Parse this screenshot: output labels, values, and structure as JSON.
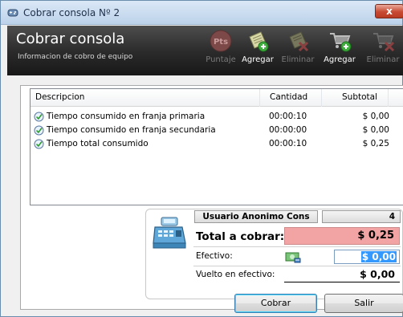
{
  "window": {
    "title": "Cobrar consola Nº 2",
    "close_label": "x"
  },
  "header": {
    "title": "Cobrar consola",
    "subtitle": "Informacion de cobro de equipo"
  },
  "toolbar": {
    "badge_text": "Pts",
    "items": [
      {
        "label": "Puntaje",
        "enabled": false,
        "icon": "points-icon"
      },
      {
        "label": "Agregar",
        "enabled": true,
        "icon": "add-document-icon"
      },
      {
        "label": "Eliminar",
        "enabled": false,
        "icon": "delete-document-icon"
      },
      {
        "label": "Agregar",
        "enabled": true,
        "icon": "add-cart-icon"
      },
      {
        "label": "Eliminar",
        "enabled": false,
        "icon": "delete-cart-icon"
      }
    ]
  },
  "table": {
    "columns": [
      "Descripcion",
      "Cantidad",
      "Subtotal"
    ],
    "rows": [
      {
        "descripcion": "Tiempo consumido en franja primaria",
        "cantidad": "00:00:10",
        "subtotal": "$ 0,00"
      },
      {
        "descripcion": "Tiempo consumido en franja secundaria",
        "cantidad": "00:00:00",
        "subtotal": "$ 0,00"
      },
      {
        "descripcion": "Tiempo total consumido",
        "cantidad": "00:00:10",
        "subtotal": "$ 0,25"
      }
    ]
  },
  "payment": {
    "user_name": "Usuario Anonimo Cons",
    "user_count": "4",
    "total_label": "Total a cobrar:",
    "total_value": "$ 0,25",
    "efectivo_label": "Efectivo:",
    "efectivo_value": "$ 0,00",
    "vuelto_label": "Vuelto en efectivo:",
    "vuelto_value": "$ 0,00"
  },
  "buttons": {
    "cobrar": "Cobrar",
    "salir": "Salir"
  },
  "colors": {
    "total_field": "#f2a3a3",
    "header_bg": "#2c2c2c"
  }
}
